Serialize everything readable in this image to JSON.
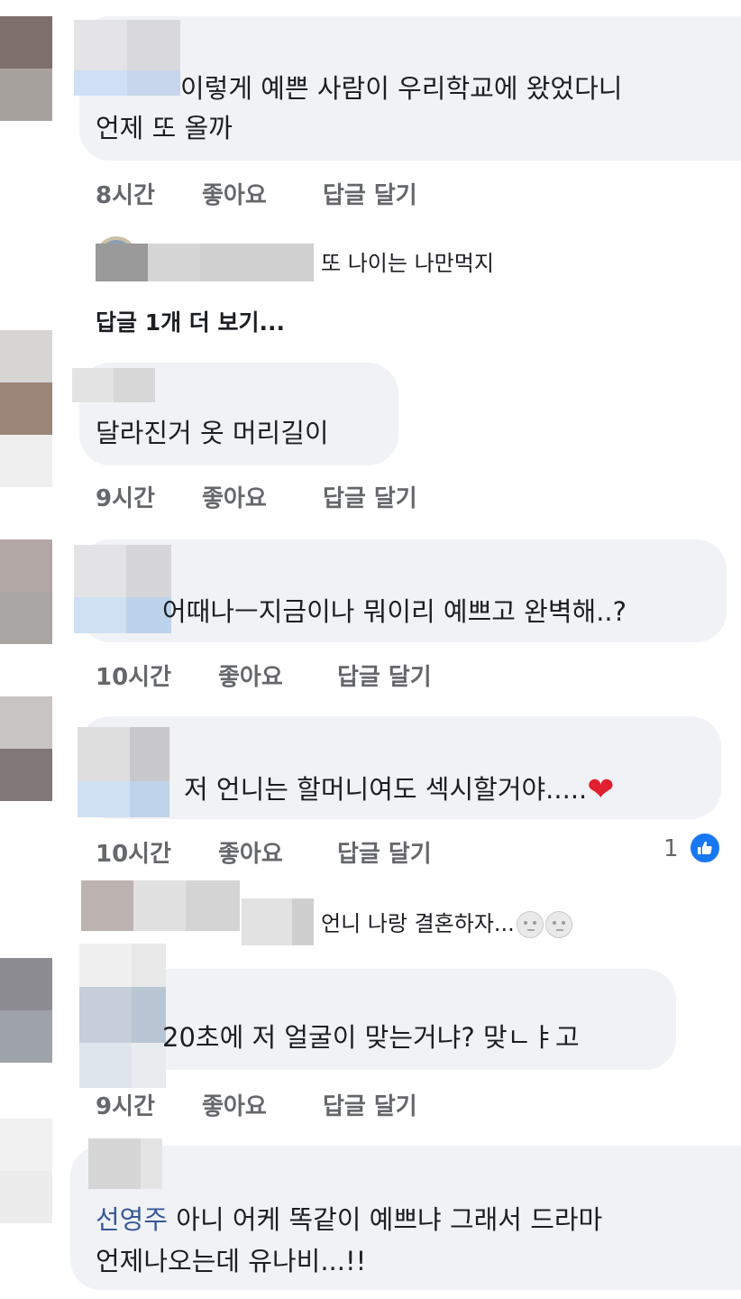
{
  "comments": [
    {
      "mention": "",
      "lines": [
        "이렇게 예쁜 사람이 우리학교에 왔었다니",
        "언제 또 올까"
      ],
      "time": "8시간",
      "like": "좋아요",
      "reply": "답글 달기"
    },
    {
      "mention": "",
      "lines": [
        "달라진거 옷 머리길이"
      ],
      "time": "9시간",
      "like": "좋아요",
      "reply": "답글 달기"
    },
    {
      "mention": "",
      "lines": [
        "어때나ㅡ지금이나 뭐이리 예쁘고 완벽해..?"
      ],
      "time": "10시간",
      "like": "좋아요",
      "reply": "답글 달기"
    },
    {
      "mention": "",
      "lines": [
        "저 언니는 할머니여도 섹시할거야....."
      ],
      "time": "10시간",
      "like": "좋아요",
      "reply": "답글 달기",
      "reaction_count": "1"
    },
    {
      "mention": "",
      "lines": [
        "20초에 저 얼굴이 맞는거냐? 맞ㄴㅑ고"
      ],
      "time": "9시간",
      "like": "좋아요",
      "reply": "답글 달기"
    },
    {
      "mention": "선영주",
      "lines": [
        "아니 어케 똑같이 예쁘냐 그래서 드라마",
        "언제나오는데 유나비...!!"
      ]
    }
  ],
  "replies": [
    {
      "text": "또 나이는 나만먹지"
    },
    {
      "text": "언니 나랑 결혼하자..."
    }
  ],
  "more_replies": "답글 1개 더 보기...",
  "icons": {
    "heart": "heart-icon",
    "like": "like-thumb-icon",
    "moon": "full-moon-face-icon"
  },
  "colors": {
    "bubble": "#f0f2f5",
    "meta": "#65676b",
    "mention": "#385898",
    "like_badge": "#1877f2",
    "heart": "#e0202f"
  }
}
